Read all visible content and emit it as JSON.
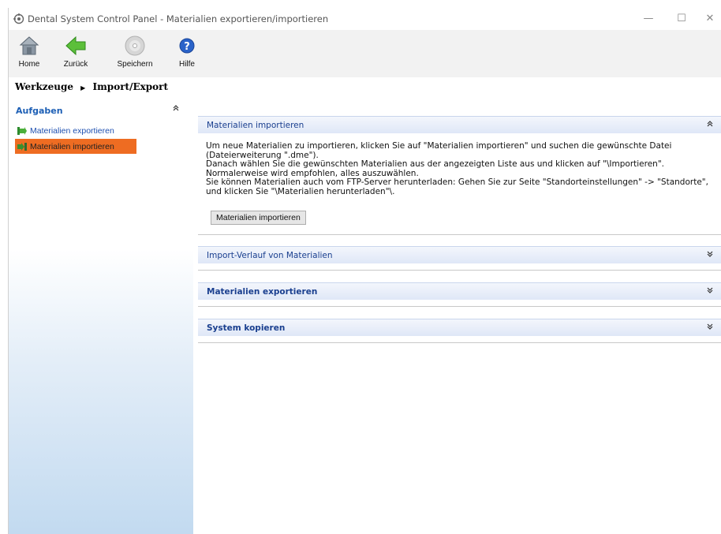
{
  "window": {
    "title": "Dental System Control Panel - Materialien exportieren/importieren",
    "minimize": "—",
    "maximize": "☐",
    "close": "✕"
  },
  "toolbar": {
    "home_label": "Home",
    "back_label": "Zurück",
    "save_label": "Speichern",
    "help_label": "Hilfe"
  },
  "breadcrumb": {
    "part1": "Werkzeuge",
    "part2": "Import/Export"
  },
  "sidebar": {
    "heading": "Aufgaben",
    "collapse": "⌃",
    "items": [
      {
        "label": "Materialien exportieren",
        "selected": false
      },
      {
        "label": "Materialien importieren",
        "selected": true
      }
    ]
  },
  "panels": {
    "import": {
      "title": "Materialien importieren",
      "chevron": "⌃",
      "lines": [
        "Um neue Materialien zu importieren, klicken Sie auf \"Materialien importieren\" und suchen die gewünschte Datei (Dateierweiterung \".dme\").",
        "Danach wählen Sie die gewünschten Materialien aus der angezeigten Liste aus und klicken auf \"\\Importieren\". Normalerweise wird empfohlen, alles auszuwählen.",
        "Sie können Materialien auch vom FTP-Server herunterladen: Gehen Sie zur Seite \"Standorteinstellungen\" ->  \"Standorte\", und klicken Sie \"\\Materialien herunterladen\"\\."
      ],
      "button_label": "Materialien importieren"
    },
    "history": {
      "title": "Import-Verlauf von Materialien",
      "chevron": "⌄"
    },
    "export": {
      "title": "Materialien exportieren",
      "chevron": "⌄"
    },
    "copy": {
      "title": "System kopieren",
      "chevron": "⌄"
    }
  },
  "colors": {
    "accent_orange": "#ee6c22",
    "link_blue": "#1d5fb5",
    "panel_title": "#1a3f8f"
  }
}
